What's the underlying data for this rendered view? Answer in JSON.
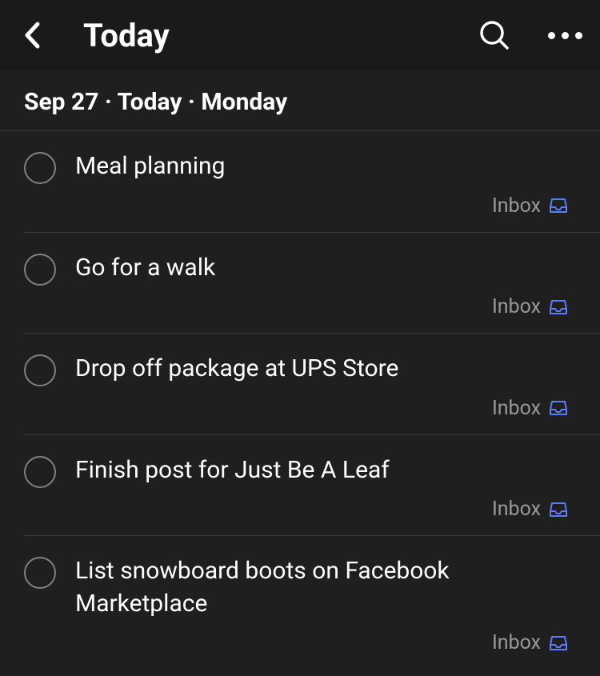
{
  "header": {
    "title": "Today"
  },
  "section": {
    "date_label": "Sep 27 · Today · Monday"
  },
  "tasks": [
    {
      "title": "Meal planning",
      "project": "Inbox"
    },
    {
      "title": "Go for a walk",
      "project": "Inbox"
    },
    {
      "title": "Drop off package at UPS Store",
      "project": "Inbox"
    },
    {
      "title": "Finish post for Just Be A Leaf",
      "project": "Inbox"
    },
    {
      "title": "List snowboard boots on Facebook Marketplace",
      "project": "Inbox"
    }
  ],
  "colors": {
    "inbox_icon": "#5c7cfa"
  }
}
